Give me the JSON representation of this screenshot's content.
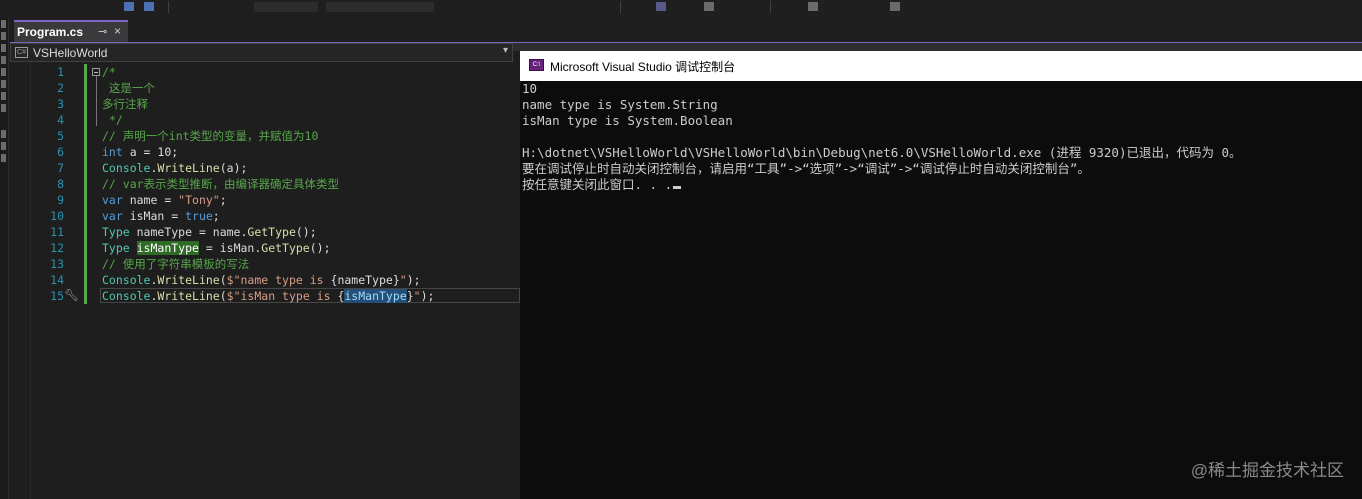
{
  "tab": {
    "title": "Program.cs",
    "pin": "⊸",
    "close": "×"
  },
  "nav": {
    "project": "VSHelloWorld",
    "chevron": "▾",
    "cs_badge": "C#"
  },
  "editor": {
    "line_numbers": [
      "1",
      "2",
      "3",
      "4",
      "5",
      "6",
      "7",
      "8",
      "9",
      "10",
      "11",
      "12",
      "13",
      "14",
      "15"
    ],
    "lines": [
      [
        {
          "t": "/*",
          "c": "c"
        }
      ],
      [
        {
          "t": " 这是一个",
          "c": "c"
        }
      ],
      [
        {
          "t": "多行注释",
          "c": "c"
        }
      ],
      [
        {
          "t": " */",
          "c": "c"
        }
      ],
      [
        {
          "t": "// 声明一个int类型的变量，并赋值为10",
          "c": "c"
        }
      ],
      [
        {
          "t": "int",
          "c": "k"
        },
        {
          "t": " a = 10;",
          "c": "p"
        }
      ],
      [
        {
          "t": "Console",
          "c": "t"
        },
        {
          "t": ".",
          "c": "p"
        },
        {
          "t": "WriteLine",
          "c": "m"
        },
        {
          "t": "(a);",
          "c": "p"
        }
      ],
      [
        {
          "t": "// var表示类型推断，由编译器确定具体类型",
          "c": "c"
        }
      ],
      [
        {
          "t": "var",
          "c": "k"
        },
        {
          "t": " name = ",
          "c": "p"
        },
        {
          "t": "\"Tony\"",
          "c": "s"
        },
        {
          "t": ";",
          "c": "p"
        }
      ],
      [
        {
          "t": "var",
          "c": "k"
        },
        {
          "t": " isMan = ",
          "c": "p"
        },
        {
          "t": "true",
          "c": "k"
        },
        {
          "t": ";",
          "c": "p"
        }
      ],
      [
        {
          "t": "Type",
          "c": "t"
        },
        {
          "t": " nameType = name.",
          "c": "p"
        },
        {
          "t": "GetType",
          "c": "m"
        },
        {
          "t": "();",
          "c": "p"
        }
      ],
      [
        {
          "t": "Type",
          "c": "t"
        },
        {
          "t": " ",
          "c": "p"
        },
        {
          "t": "isManType",
          "c": "hl-green"
        },
        {
          "t": " = isMan.",
          "c": "p"
        },
        {
          "t": "GetType",
          "c": "m"
        },
        {
          "t": "();",
          "c": "p"
        }
      ],
      [
        {
          "t": "// 使用了字符串模板的写法",
          "c": "c"
        }
      ],
      [
        {
          "t": "Console",
          "c": "t"
        },
        {
          "t": ".",
          "c": "p"
        },
        {
          "t": "WriteLine",
          "c": "m"
        },
        {
          "t": "(",
          "c": "p"
        },
        {
          "t": "$\"name type is ",
          "c": "s"
        },
        {
          "t": "{nameType}",
          "c": "p"
        },
        {
          "t": "\"",
          "c": "s"
        },
        {
          "t": ");",
          "c": "p"
        }
      ],
      [
        {
          "t": "Console",
          "c": "t"
        },
        {
          "t": ".",
          "c": "p"
        },
        {
          "t": "WriteLine",
          "c": "m"
        },
        {
          "t": "(",
          "c": "p"
        },
        {
          "t": "$\"isMan type is ",
          "c": "s"
        },
        {
          "t": "{",
          "c": "p"
        },
        {
          "t": "isManType",
          "c": "hl-blue"
        },
        {
          "t": "}",
          "c": "p"
        },
        {
          "t": "\"",
          "c": "s"
        },
        {
          "t": ");",
          "c": "p"
        }
      ]
    ]
  },
  "console": {
    "title": "Microsoft Visual Studio 调试控制台",
    "icon_label": "C:\\",
    "lines": [
      "10",
      "name type is System.String",
      "isMan type is System.Boolean",
      "",
      "H:\\dotnet\\VSHelloWorld\\VSHelloWorld\\bin\\Debug\\net6.0\\VSHelloWorld.exe (进程 9320)已退出，代码为 0。",
      "要在调试停止时自动关闭控制台，请启用“工具”->“选项”->“调试”->“调试停止时自动关闭控制台”。",
      "按任意键关闭此窗口. . ."
    ]
  },
  "watermark": "@稀土掘金技术社区"
}
